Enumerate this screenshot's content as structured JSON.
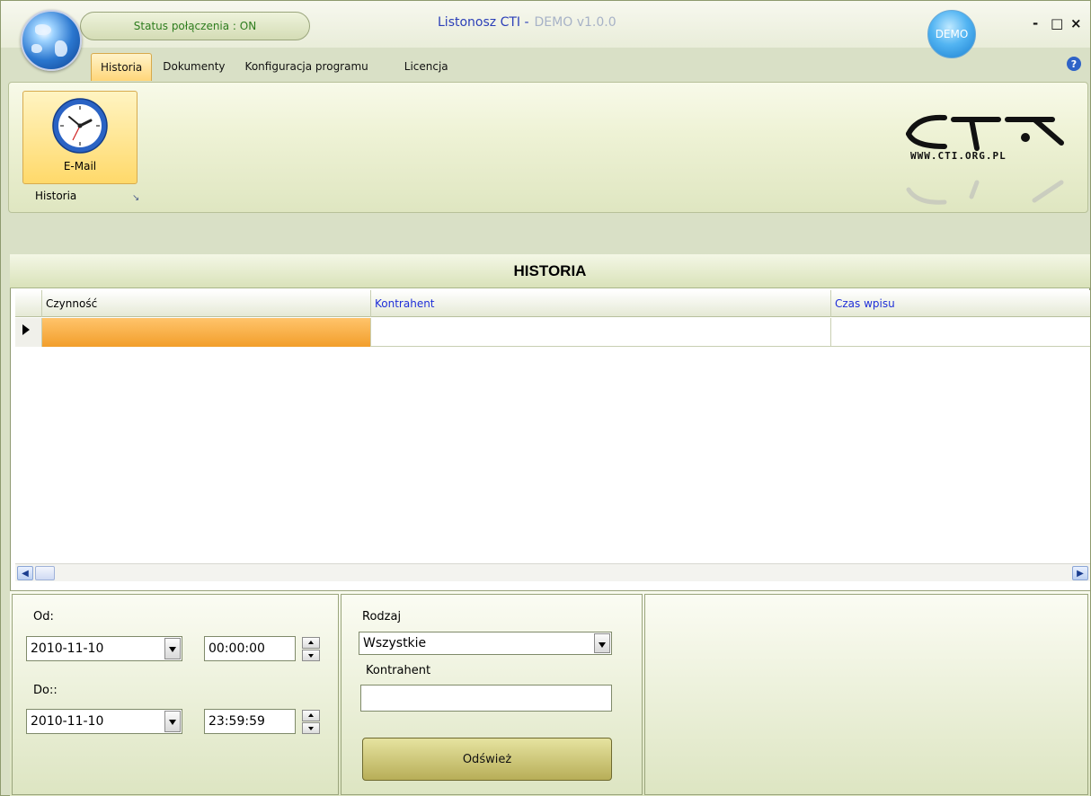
{
  "titlebar": {
    "status": "Status połączenia : ON",
    "app_name": "Listonosz CTI  -",
    "app_version": "DEMO v1.0.0",
    "demo_badge": "DEMO",
    "minimize": "-",
    "maximize": "□",
    "close": "×"
  },
  "menu": {
    "tabs": [
      "Historia",
      "Dokumenty",
      "Konfiguracja programu",
      "Licencja"
    ],
    "help": "?"
  },
  "ribbon": {
    "email_button": "E-Mail",
    "group_label": "Historia",
    "launcher": "↘",
    "logo_url": "WWW.CTI.ORG.PL"
  },
  "panel": {
    "title": "HISTORIA",
    "columns": [
      "Czynność",
      "Kontrahent",
      "Czas wpisu"
    ],
    "rows": [
      [
        "",
        "",
        ""
      ]
    ]
  },
  "filters": {
    "od_label": "Od:",
    "od_date": "2010-11-10",
    "od_time": "00:00:00",
    "do_label": "Do::",
    "do_date": "2010-11-10",
    "do_time": "23:59:59",
    "rodzaj_label": "Rodzaj",
    "rodzaj_value": "Wszystkie",
    "kontrahent_label": "Kontrahent",
    "kontrahent_value": "",
    "refresh_button": "Odśwież"
  },
  "colors": {
    "accent_orange": "#f29e2b",
    "status_green": "#2e7d1e",
    "title_blue": "#2b3fb8",
    "column_blue": "#1f2fd8"
  }
}
